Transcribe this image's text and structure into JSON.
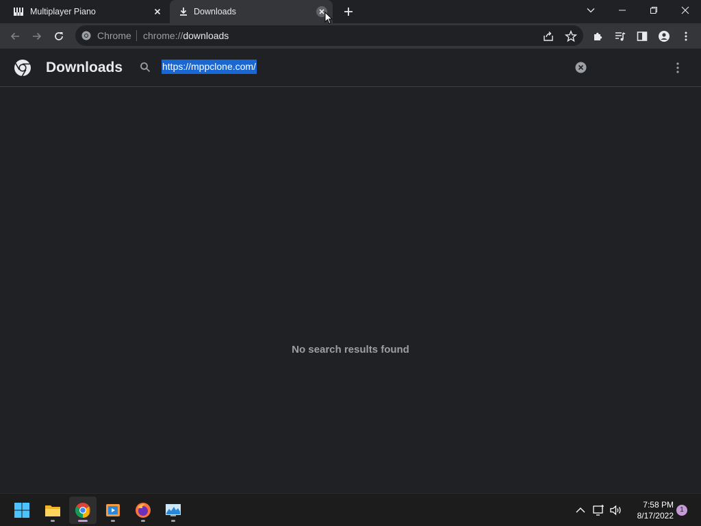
{
  "browser": {
    "tabs": [
      {
        "title": "Multiplayer Piano",
        "icon": "piano-icon",
        "active": false
      },
      {
        "title": "Downloads",
        "icon": "download-icon",
        "active": true
      }
    ],
    "omnibox": {
      "chip": "Chrome",
      "url_scheme": "chrome://",
      "url_host": "downloads"
    }
  },
  "downloads": {
    "title": "Downloads",
    "search_value": "https://mppclone.com/",
    "empty_message": "No search results found"
  },
  "taskbar": {
    "apps": [
      "start-icon",
      "file-explorer-icon",
      "chrome-icon",
      "media-player-icon",
      "firefox-icon",
      "monitor-app-icon"
    ],
    "time": "7:58 PM",
    "date": "8/17/2022",
    "notification_count": "1"
  },
  "colors": {
    "page_bg": "#202124",
    "toolbar_bg": "#35363a",
    "selection": "#1967d2",
    "accent": "#c69ad8"
  }
}
